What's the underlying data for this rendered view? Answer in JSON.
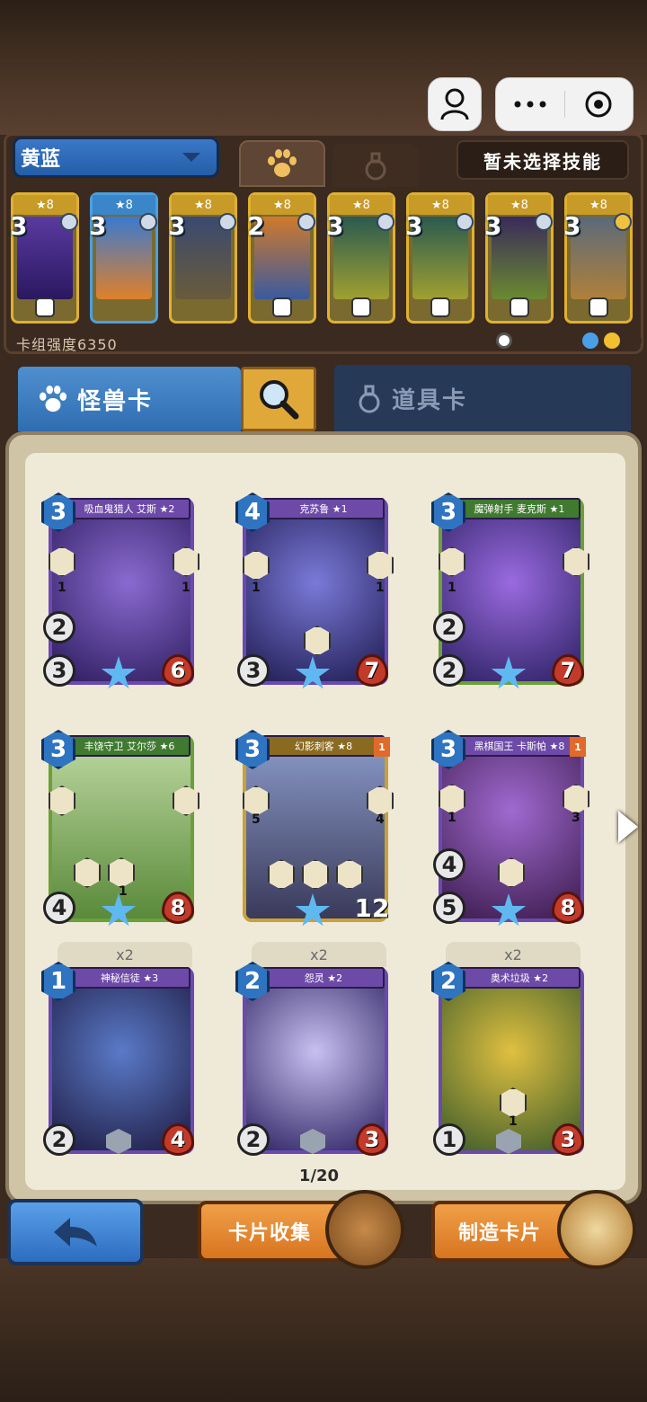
{
  "deck": {
    "name": "黄蓝",
    "skill_label": "暂未选择技能",
    "power_label": "卡组强度6350",
    "cards": [
      {
        "stars": "★8",
        "cost": "3",
        "color": "gold"
      },
      {
        "stars": "★8",
        "cost": "3",
        "color": "blue"
      },
      {
        "stars": "★8",
        "cost": "3",
        "color": "gold"
      },
      {
        "stars": "★8",
        "cost": "2",
        "color": "gold"
      },
      {
        "stars": "★8",
        "cost": "3",
        "color": "gold"
      },
      {
        "stars": "★8",
        "cost": "3",
        "color": "gold"
      },
      {
        "stars": "★8",
        "cost": "3",
        "color": "gold"
      },
      {
        "stars": "★8",
        "cost": "3",
        "color": "gold"
      }
    ]
  },
  "tabs": {
    "monster_label": "怪兽卡",
    "item_label": "道具卡"
  },
  "cards": [
    {
      "name": "吸血鬼猎人 艾斯 ★2",
      "cost": "3",
      "speed": "2",
      "atk": "3",
      "hp": "6",
      "ab1": "1",
      "ab2": "1"
    },
    {
      "name": "克苏鲁 ★1",
      "cost": "4",
      "speed": "",
      "atk": "3",
      "hp": "7",
      "ab1": "1",
      "ab2": "1"
    },
    {
      "name": "魔弹射手 麦克斯 ★1",
      "cost": "3",
      "speed": "2",
      "atk": "2",
      "hp": "7",
      "ab1": "1",
      "ab2": ""
    },
    {
      "name": "丰饶守卫 艾尔莎 ★6",
      "cost": "3",
      "speed": "",
      "atk": "4",
      "hp": "8",
      "ab1": "1",
      "ab2": ""
    },
    {
      "name": "幻影刺客 ★8",
      "cost": "3",
      "speed": "",
      "atk": "",
      "hp": "12",
      "ab1": "5",
      "ab2": "4",
      "tag": "1"
    },
    {
      "name": "黑棋国王 卡斯帕 ★8",
      "cost": "3",
      "speed": "4",
      "atk": "5",
      "hp": "8",
      "ab1": "1",
      "ab2": "3",
      "tag": "1"
    },
    {
      "name": "神秘信徒 ★3",
      "cost": "1",
      "speed": "",
      "atk": "2",
      "hp": "4",
      "copies": "x2"
    },
    {
      "name": "怨灵 ★2",
      "cost": "2",
      "speed": "",
      "atk": "2",
      "hp": "3",
      "copies": "x2"
    },
    {
      "name": "奥术垃圾 ★2",
      "cost": "2",
      "speed": "",
      "atk": "1",
      "hp": "3",
      "ab1": "1",
      "copies": "x2"
    }
  ],
  "pagination": "1/20",
  "buttons": {
    "collect_label": "卡片收集",
    "craft_label": "制造卡片"
  }
}
